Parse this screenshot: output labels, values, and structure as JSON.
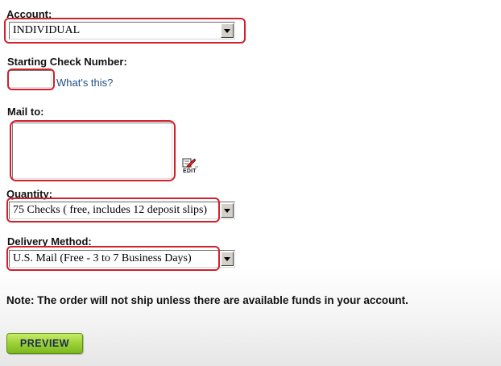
{
  "account": {
    "label": "Account:",
    "selected": "INDIVIDUAL"
  },
  "check_number": {
    "label": "Starting Check Number:",
    "value": "",
    "help_link": "What's this?"
  },
  "mail_to": {
    "label": "Mail to:",
    "value": "",
    "edit_label": "EDIT",
    "edit_icon": "edit-pencil-icon"
  },
  "quantity": {
    "label": "Quantity:",
    "selected": "75 Checks ( free, includes 12 deposit slips)"
  },
  "delivery": {
    "label": "Delivery Method:",
    "selected": "U.S. Mail (Free - 3 to 7 Business Days)"
  },
  "note": "Note: The order will not ship unless there are available funds in your account.",
  "preview_button": "PREVIEW",
  "colors": {
    "highlight": "#d0202a",
    "link": "#1f4f86",
    "button_green": "#9fd33a",
    "button_text": "#1a2a52"
  }
}
